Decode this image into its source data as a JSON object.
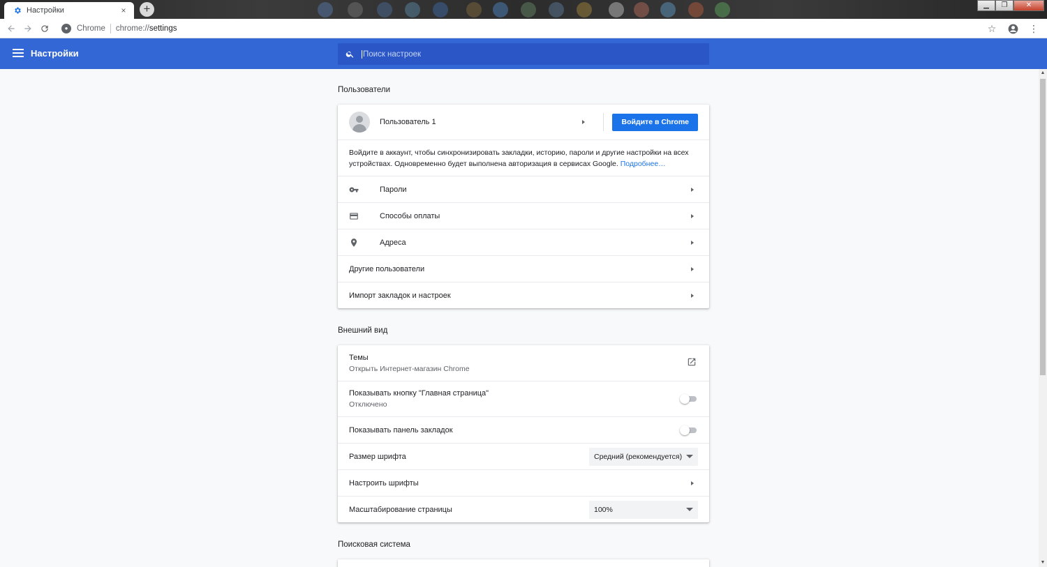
{
  "browser": {
    "tab_title": "Настройки",
    "tab_close": "×",
    "new_tab": "+",
    "omnibox_origin": "Chrome",
    "omnibox_scheme": "chrome://",
    "omnibox_path": "settings"
  },
  "header": {
    "title": "Настройки",
    "search_placeholder": "Поиск настроек"
  },
  "sections": {
    "people": {
      "title": "Пользователи",
      "user_name": "Пользователь 1",
      "signin_button": "Войдите в Chrome",
      "description": "Войдите в аккаунт, чтобы синхронизировать закладки, историю, пароли и другие настройки на всех устройствах. Одновременно будет выполнена авторизация в сервисах Google. ",
      "learn_more": "Подробнее…",
      "items": [
        {
          "label": "Пароли",
          "icon": "key-icon"
        },
        {
          "label": "Способы оплаты",
          "icon": "credit-card-icon"
        },
        {
          "label": "Адреса",
          "icon": "location-pin-icon"
        },
        {
          "label": "Другие пользователи"
        },
        {
          "label": "Импорт закладок и настроек"
        }
      ]
    },
    "appearance": {
      "title": "Внешний вид",
      "themes_label": "Темы",
      "themes_sub": "Открыть Интернет-магазин Chrome",
      "home_button_label": "Показывать кнопку \"Главная страница\"",
      "home_button_sub": "Отключено",
      "home_button_enabled": false,
      "bookmarks_bar_label": "Показывать панель закладок",
      "bookmarks_bar_enabled": false,
      "font_size_label": "Размер шрифта",
      "font_size_value": "Средний (рекомендуется)",
      "customize_fonts_label": "Настроить шрифты",
      "zoom_label": "Масштабирование страницы",
      "zoom_value": "100%"
    },
    "search_engine": {
      "title": "Поисковая система"
    }
  },
  "colors": {
    "header": "#3367d6",
    "search_bg": "#2a56c6",
    "accent": "#1a73e8",
    "page_bg": "#f8f9fa"
  }
}
